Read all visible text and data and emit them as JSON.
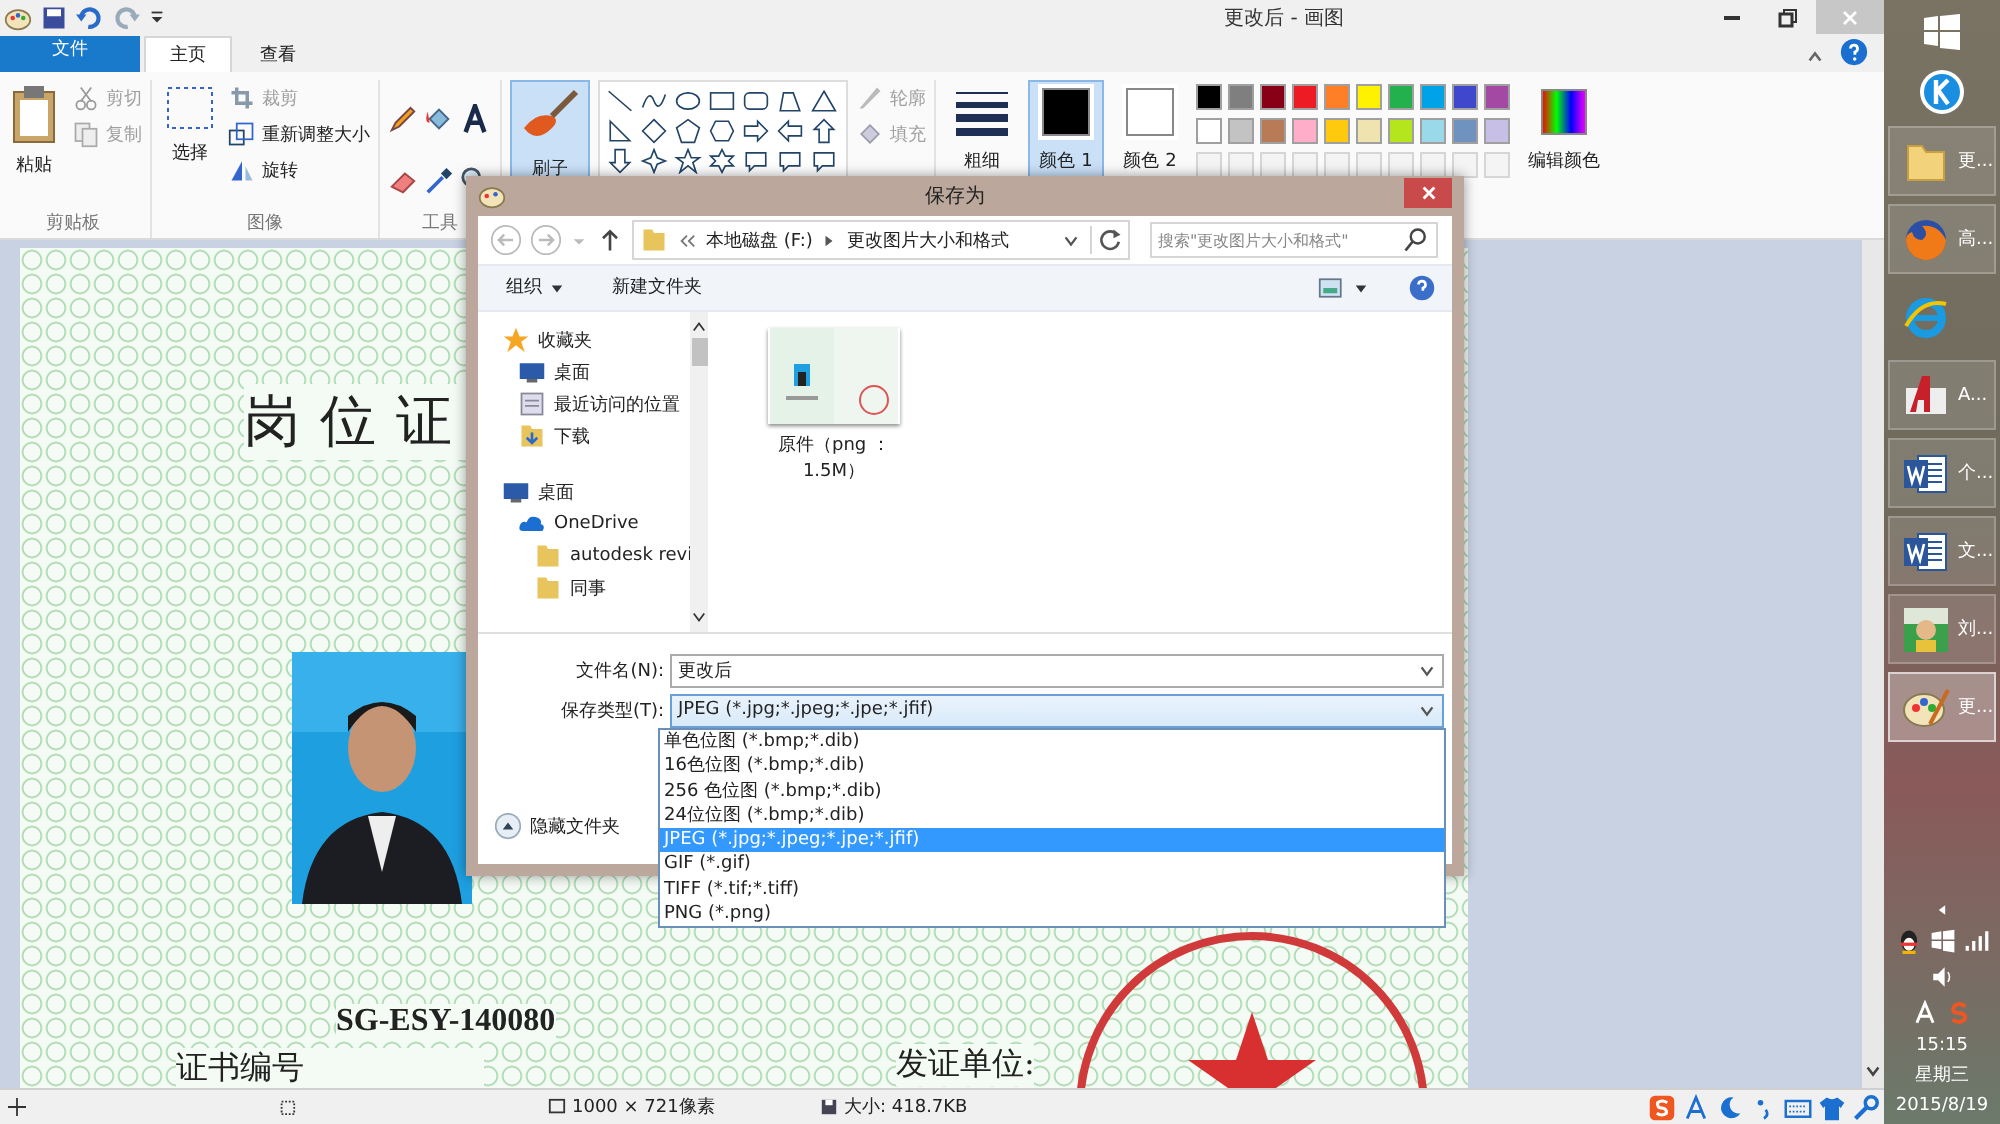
{
  "window": {
    "title": "更改后 - 画图"
  },
  "ribbon": {
    "tabs": [
      {
        "label": "文件",
        "kind": "file",
        "selected": false
      },
      {
        "label": "主页",
        "kind": "tab",
        "selected": true
      },
      {
        "label": "查看",
        "kind": "tab",
        "selected": false
      }
    ],
    "clipboard": {
      "label": "剪贴板",
      "paste": "粘贴",
      "items": [
        {
          "label": "剪切",
          "disabled": true
        },
        {
          "label": "复制",
          "disabled": true
        }
      ]
    },
    "image": {
      "label": "图像",
      "select": "选择",
      "items": [
        {
          "label": "裁剪",
          "disabled": true
        },
        {
          "label": "重新调整大小",
          "disabled": false
        },
        {
          "label": "旋转",
          "disabled": false
        }
      ]
    },
    "tools": {
      "label": "工具"
    },
    "brush": {
      "label": "刷子",
      "selected": true
    },
    "shapes": {
      "outline": {
        "label": "轮廓",
        "disabled": true
      },
      "fill": {
        "label": "填充",
        "disabled": true
      }
    },
    "size": {
      "label": "粗细"
    },
    "colors": [
      {
        "label": "颜色 1",
        "color": "#000000",
        "selected": true
      },
      {
        "label": "颜色 2",
        "color": "#ffffff",
        "selected": false
      }
    ],
    "palette": [
      {
        "color": "#000000"
      },
      {
        "color": "#7f7f7f"
      },
      {
        "color": "#880015"
      },
      {
        "color": "#ed1c24"
      },
      {
        "color": "#ff7f27"
      },
      {
        "color": "#fff200"
      },
      {
        "color": "#22b14c"
      },
      {
        "color": "#00a2e8"
      },
      {
        "color": "#3f48cc"
      },
      {
        "color": "#a349a4"
      },
      {
        "color": "#ffffff"
      },
      {
        "color": "#c3c3c3"
      },
      {
        "color": "#b97a57"
      },
      {
        "color": "#ffaec9"
      },
      {
        "color": "#ffc90e"
      },
      {
        "color": "#efe4b0"
      },
      {
        "color": "#b5e61d"
      },
      {
        "color": "#99d9ea"
      },
      {
        "color": "#7092be"
      },
      {
        "color": "#c8bfe7"
      }
    ],
    "edit_colors": "编辑颜色"
  },
  "document": {
    "title": "岗位证",
    "number": "SG-ESY-140080",
    "number_label": "证书编号",
    "issuer_label": "发证单位:"
  },
  "dialog": {
    "title": "保存为",
    "breadcrumb": [
      "本地磁盘 (F:)",
      "更改图片大小和格式"
    ],
    "search": {
      "placeholder": "搜索\"更改图片大小和格式\""
    },
    "toolbar": [
      "组织",
      "新建文件夹"
    ],
    "tree": [
      {
        "label": "收藏夹",
        "kind": "star",
        "children": [
          {
            "label": "桌面",
            "kind": "desktop"
          },
          {
            "label": "最近访问的位置",
            "kind": "recent"
          },
          {
            "label": "下载",
            "kind": "download"
          }
        ]
      },
      {
        "label": "桌面",
        "kind": "desktop",
        "children": [
          {
            "label": "OneDrive",
            "kind": "cloud",
            "children": [
              {
                "label": "autodesk revi",
                "kind": "folder"
              },
              {
                "label": "同事",
                "kind": "folder"
              }
            ]
          }
        ]
      }
    ],
    "files": [
      {
        "name": "原件（png ：1.5M）"
      }
    ],
    "filename_label": "文件名(N):",
    "filename": "更改后",
    "type_label": "保存类型(T):",
    "type": "JPEG (*.jpg;*.jpeg;*.jpe;*.jfif)",
    "type_options": [
      {
        "label": "单色位图 (*.bmp;*.dib)",
        "selected": false
      },
      {
        "label": "16色位图 (*.bmp;*.dib)",
        "selected": false
      },
      {
        "label": "256 色位图 (*.bmp;*.dib)",
        "selected": false
      },
      {
        "label": "24位位图 (*.bmp;*.dib)",
        "selected": false
      },
      {
        "label": "JPEG (*.jpg;*.jpeg;*.jpe;*.jfif)",
        "selected": true
      },
      {
        "label": "GIF (*.gif)",
        "selected": false
      },
      {
        "label": "TIFF (*.tif;*.tiff)",
        "selected": false
      },
      {
        "label": "PNG (*.png)",
        "selected": false
      }
    ],
    "hide_folders": "隐藏文件夹"
  },
  "status_bar": {
    "dimensions": "1000 × 721像素",
    "size": "大小: 418.7KB"
  },
  "taskbar": {
    "items": [
      {
        "label": "更...",
        "kind": "folder",
        "selected": false
      },
      {
        "label": "高...",
        "kind": "firefox",
        "selected": false
      },
      {
        "kind": "ie",
        "selected": false
      },
      {
        "label": "A...",
        "kind": "cad",
        "selected": false
      },
      {
        "label": "个...",
        "kind": "word",
        "selected": false
      },
      {
        "label": "文...",
        "kind": "word",
        "selected": false
      },
      {
        "label": "刘...",
        "selected": false
      },
      {
        "label": "更...",
        "kind": "paint",
        "selected": true
      }
    ],
    "clock": {
      "time": "15:15",
      "day": "星期三",
      "date": "2015/8/19"
    }
  }
}
